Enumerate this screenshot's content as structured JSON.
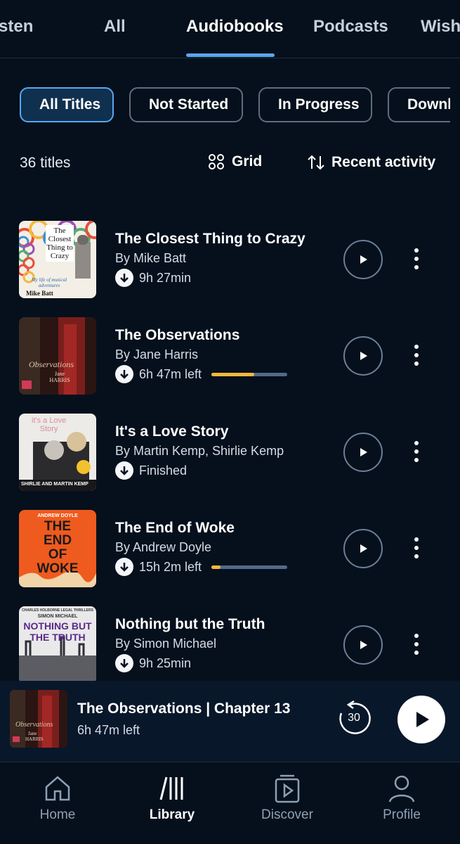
{
  "tabs": [
    {
      "label": "Listen",
      "shown": "sten"
    },
    {
      "label": "All"
    },
    {
      "label": "Audiobooks"
    },
    {
      "label": "Podcasts"
    },
    {
      "label": "Wish",
      "shown": "Wish"
    }
  ],
  "active_tab": "Audiobooks",
  "filters": [
    {
      "label": "All Titles"
    },
    {
      "label": "Not Started"
    },
    {
      "label": "In Progress"
    },
    {
      "label": "Downl"
    }
  ],
  "active_filter": "All Titles",
  "controls": {
    "count": "36 titles",
    "grid_label": "Grid",
    "sort_label": "Recent activity"
  },
  "books": [
    {
      "title": "The Closest Thing to Crazy",
      "author": "By Mike Batt",
      "status": "9h 27min",
      "progress": null,
      "cover": {
        "bg": "#f3efe6",
        "lines": [
          "The",
          "Closest",
          "Thing to",
          "Crazy"
        ],
        "foot": "My life of musical adventures",
        "name": "Mike Batt"
      }
    },
    {
      "title": "The Observations",
      "author": "By Jane Harris",
      "status": "6h 47m left",
      "progress": 0.56,
      "cover": {
        "bg": "#2a1513",
        "lines": [
          "Observations"
        ],
        "name": "Jane HARRIS"
      }
    },
    {
      "title": "It's a Love Story",
      "author": "By Martin Kemp, Shirlie Kemp",
      "status": "Finished",
      "progress": null,
      "cover": {
        "bg": "#ecebe7",
        "lines": [
          "it's a Love",
          "Story"
        ],
        "name": "SHIRLIE AND MARTIN KEMP"
      }
    },
    {
      "title": "The End of Woke",
      "author": "By Andrew Doyle",
      "status": "15h 2m left",
      "progress": 0.12,
      "cover": {
        "bg": "#ef5a1e",
        "top": "ANDREW DOYLE",
        "lines": [
          "THE",
          "END",
          "OF",
          "WOKE"
        ]
      }
    },
    {
      "title": "Nothing but the Truth",
      "author": "By Simon Michael",
      "status": "9h 25min",
      "progress": null,
      "cover": {
        "bg": "#e9e9ea",
        "top": "CHARLES HOLBORNE LEGAL THRILLERS",
        "name": "SIMON MICHAEL",
        "lines": [
          "NOTHING BUT",
          "THE TRUTH"
        ]
      }
    }
  ],
  "player": {
    "title": "The Observations | Chapter 13",
    "subtitle": "6h 47m left",
    "skip_seconds": "30"
  },
  "nav": [
    {
      "label": "Home",
      "icon": "home-icon"
    },
    {
      "label": "Library",
      "icon": "library-icon"
    },
    {
      "label": "Discover",
      "icon": "discover-icon"
    },
    {
      "label": "Profile",
      "icon": "profile-icon"
    }
  ],
  "active_nav": "Library",
  "colors": {
    "background": "#05101c",
    "accent": "#5aa6ee",
    "progress": "#f4b73d"
  }
}
